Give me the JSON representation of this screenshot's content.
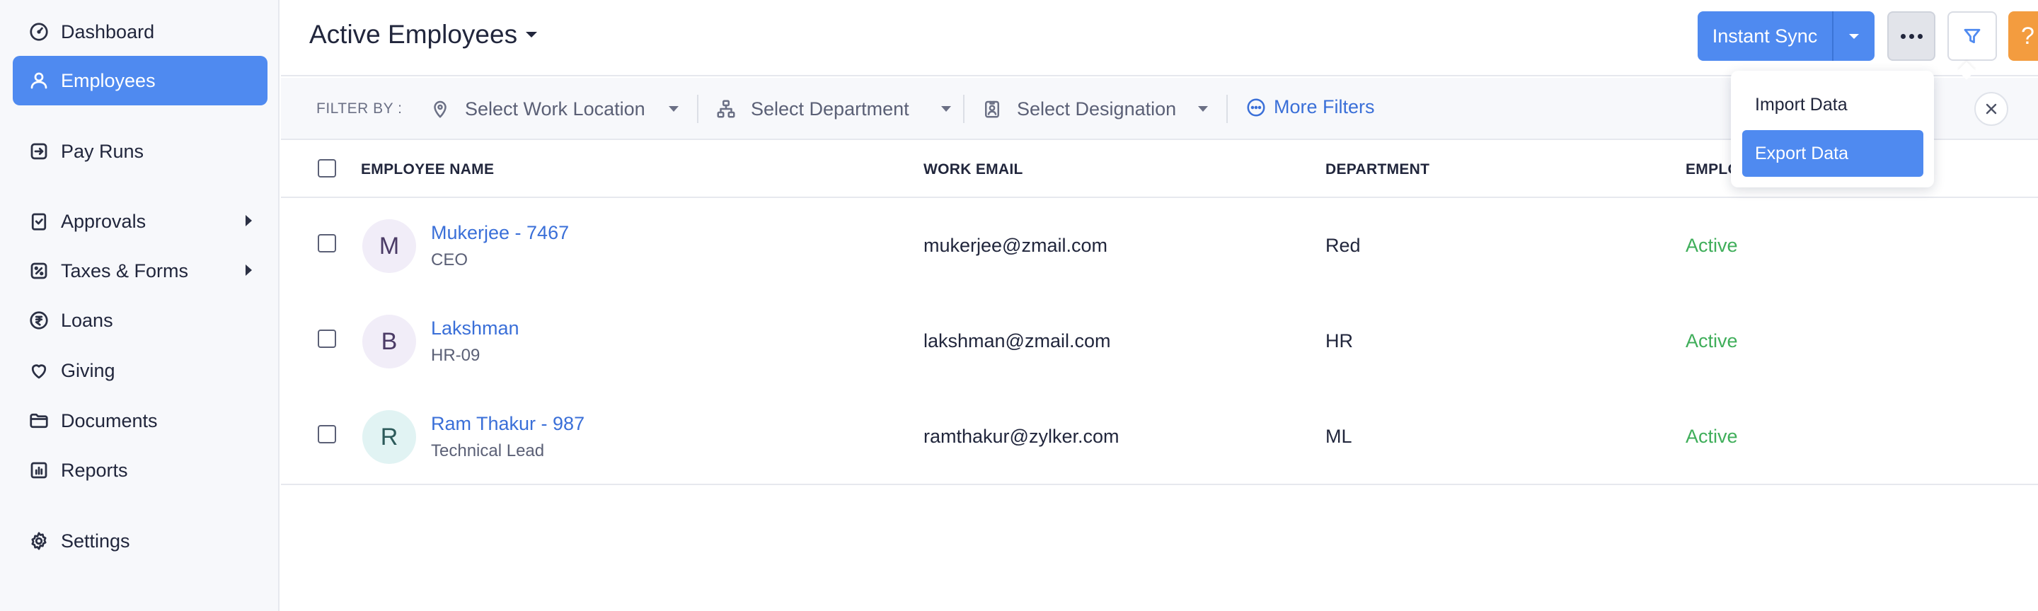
{
  "sidebar": {
    "items": [
      {
        "label": "Dashboard",
        "icon": "dashboard-icon"
      },
      {
        "label": "Employees",
        "icon": "person-icon",
        "active": true
      },
      {
        "label": "Pay Runs",
        "icon": "payrun-icon"
      },
      {
        "label": "Approvals",
        "icon": "approval-icon",
        "submenu": true
      },
      {
        "label": "Taxes & Forms",
        "icon": "tax-icon",
        "submenu": true
      },
      {
        "label": "Loans",
        "icon": "rupee-icon"
      },
      {
        "label": "Giving",
        "icon": "heart-icon"
      },
      {
        "label": "Documents",
        "icon": "folder-icon"
      },
      {
        "label": "Reports",
        "icon": "reports-icon"
      },
      {
        "label": "Settings",
        "icon": "gear-icon"
      }
    ]
  },
  "header": {
    "title": "Active Employees",
    "sync_label": "Instant Sync",
    "help_label": "?"
  },
  "filters": {
    "label": "FILTER BY :",
    "work_location": "Select Work Location",
    "department": "Select Department",
    "designation": "Select Designation",
    "more": "More Filters"
  },
  "menu": {
    "items": [
      "Import Data",
      "Export Data"
    ],
    "selected": "Export Data"
  },
  "table": {
    "columns": [
      "EMPLOYEE NAME",
      "WORK EMAIL",
      "DEPARTMENT",
      "EMPLO"
    ],
    "rows": [
      {
        "initial": "M",
        "name": "Mukerjee - 7467",
        "designation": "CEO",
        "email": "mukerjee@zmail.com",
        "department": "Red",
        "status": "Active"
      },
      {
        "initial": "B",
        "name": "Lakshman",
        "designation": "HR-09",
        "email": "lakshman@zmail.com",
        "department": "HR",
        "status": "Active"
      },
      {
        "initial": "R",
        "name": "Ram Thakur - 987",
        "designation": "Technical Lead",
        "email": "ramthakur@zylker.com",
        "department": "ML",
        "status": "Active"
      }
    ]
  },
  "colors": {
    "accent": "#4f8af0",
    "status_active": "#3fae5a",
    "help": "#f39c3f",
    "link": "#3a6fd8"
  }
}
